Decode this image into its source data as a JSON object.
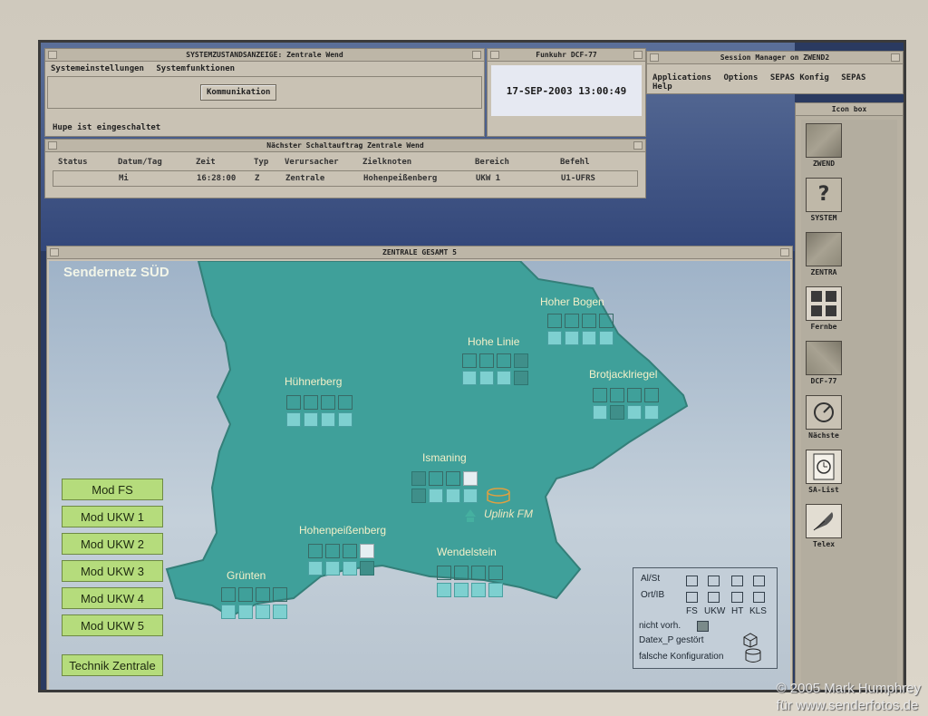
{
  "system_window": {
    "title": "SYSTEMZUSTANDSANZEIGE: Zentrale Wend",
    "menu": [
      "Systemeinstellungen",
      "Systemfunktionen"
    ],
    "kommunikation_button": "Kommunikation",
    "status_text": "Hupe ist eingeschaltet"
  },
  "clock_window": {
    "title": "Funkuhr DCF-77",
    "datetime": "17-SEP-2003 13:00:49"
  },
  "session_window": {
    "title": "Session Manager on ZWEND2",
    "menu": [
      "Applications",
      "Options",
      "SEPAS Konfig",
      "SEPAS",
      "Help"
    ]
  },
  "schedule_window": {
    "title": "Nächster Schaltauftrag Zentrale Wend",
    "headers": [
      "Status",
      "Datum/Tag",
      "Zeit",
      "Typ",
      "Verursacher",
      "Zielknoten",
      "Bereich",
      "Befehl"
    ],
    "row": [
      "",
      "Mi",
      "16:28:00",
      "Z",
      "Zentrale",
      "Hohenpeißenberg",
      "UKW 1",
      "U1-UFRS"
    ]
  },
  "iconbox": {
    "title": "Icon box",
    "items": [
      {
        "label": "ZWEND",
        "icon": "map-thumbnail-icon"
      },
      {
        "label": "SYSTEM",
        "icon": "question-mark-icon"
      },
      {
        "label": "ZENTRA",
        "icon": "map-thumbnail-icon"
      },
      {
        "label": "Fernbe",
        "icon": "grid-windows-icon"
      },
      {
        "label": "DCF-77",
        "icon": "map-thumbnail-icon"
      },
      {
        "label": "Nächste",
        "icon": "switch-icon"
      },
      {
        "label": "SA-List",
        "icon": "clock-list-icon"
      },
      {
        "label": "Telex",
        "icon": "feather-icon"
      }
    ]
  },
  "map_window": {
    "title": "ZENTRALE GESAMT 5",
    "map_title": "Sendernetz SÜD",
    "sites": {
      "hoher_bogen": "Hoher Bogen",
      "hohe_linie": "Hohe Linie",
      "huehnerberg": "Hühnerberg",
      "brotjacklriegel": "Brotjacklriegel",
      "ismaning": "Ismaning",
      "uplink": "Uplink FM",
      "hohenpeissenberg": "Hohenpeißenberg",
      "wendelstein": "Wendelstein",
      "gruenten": "Grünten"
    },
    "buttons": [
      "Mod FS",
      "Mod UKW 1",
      "Mod UKW 2",
      "Mod UKW 3",
      "Mod UKW 4",
      "Mod UKW 5",
      "Technik Zentrale"
    ],
    "legend": {
      "row1": "Al/St",
      "row2": "Ort/IB",
      "cols": [
        "FS",
        "UKW",
        "HT",
        "KLS"
      ],
      "not_present": "nicht vorh.",
      "datex": "Datex_P gestört",
      "wrong_config": "falsche Konfiguration"
    },
    "colors": {
      "region": "#3fa09a",
      "cell_on": "#7ed0d0",
      "button": "#b5dc7c",
      "uplink": "#e0a040"
    }
  },
  "copyright": {
    "line1": "© 2005 Mark Humphrey",
    "line2": "für www.senderfotos.de"
  }
}
